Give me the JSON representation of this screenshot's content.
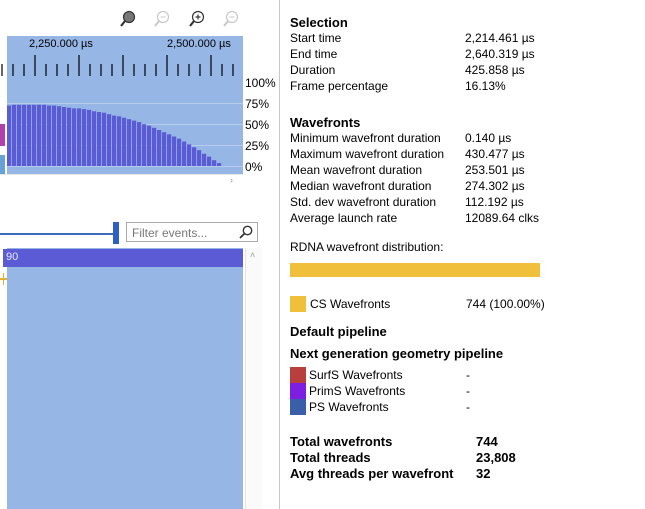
{
  "toolbar": {
    "icons": [
      "zoom-to-selection-icon",
      "zoom-reset-icon",
      "zoom-in-icon",
      "zoom-out-icon"
    ]
  },
  "timeline": {
    "tick_labels": [
      "2,250.000 µs",
      "2,500.000 µs"
    ],
    "percent_labels": [
      "100%",
      "75%",
      "50%",
      "25%",
      "0%"
    ]
  },
  "filter": {
    "placeholder": "Filter events..."
  },
  "event_lane": {
    "label": "90"
  },
  "selection": {
    "heading": "Selection",
    "rows": [
      {
        "label": "Start time",
        "value": "2,214.461 µs"
      },
      {
        "label": "End time",
        "value": "2,640.319 µs"
      },
      {
        "label": "Duration",
        "value": "425.858 µs"
      },
      {
        "label": "Frame percentage",
        "value": "16.13%"
      }
    ]
  },
  "wavefronts": {
    "heading": "Wavefronts",
    "rows": [
      {
        "label": "Minimum wavefront duration",
        "value": "0.140 µs"
      },
      {
        "label": "Maximum wavefront duration",
        "value": "430.477 µs"
      },
      {
        "label": "Mean wavefront duration",
        "value": "253.501 µs"
      },
      {
        "label": "Median wavefront duration",
        "value": "274.302 µs"
      },
      {
        "label": "Std. dev wavefront duration",
        "value": "112.192 µs"
      },
      {
        "label": "Average launch rate",
        "value": "12089.64 clks"
      }
    ]
  },
  "distribution": {
    "title": "RDNA wavefront distribution:",
    "bar_color": "#f0c03c",
    "bar_fraction": 1.0,
    "entries": [
      {
        "label": "CS Wavefronts",
        "value": "744 (100.00%)",
        "color": "#f0c03c"
      }
    ]
  },
  "default_pipeline": {
    "heading": "Default pipeline"
  },
  "ngg_pipeline": {
    "heading": "Next generation geometry pipeline",
    "entries": [
      {
        "label": "SurfS Wavefronts",
        "value": "-",
        "color": "#b8403c"
      },
      {
        "label": "PrimS Wavefronts",
        "value": "-",
        "color": "#7d1fe0"
      },
      {
        "label": "PS Wavefronts",
        "value": "-",
        "color": "#3b5ea8"
      }
    ]
  },
  "totals": {
    "rows": [
      {
        "label": "Total wavefronts",
        "value": "744"
      },
      {
        "label": "Total threads",
        "value": "23,808"
      },
      {
        "label": "Avg threads per wavefront",
        "value": "32"
      }
    ]
  },
  "colors": {
    "timeline_bg": "#96b6e6",
    "histogram_bar": "#5b5bd6",
    "lane_header": "#5b5bd6"
  },
  "histogram_levels": [
    0.84,
    0.85,
    0.85,
    0.85,
    0.85,
    0.85,
    0.85,
    0.85,
    0.84,
    0.84,
    0.83,
    0.82,
    0.81,
    0.8,
    0.8,
    0.79,
    0.78,
    0.76,
    0.75,
    0.74,
    0.72,
    0.7,
    0.69,
    0.67,
    0.65,
    0.63,
    0.61,
    0.58,
    0.56,
    0.53,
    0.5,
    0.47,
    0.44,
    0.41,
    0.38,
    0.34,
    0.3,
    0.26,
    0.22,
    0.17,
    0.13,
    0.08,
    0.04
  ]
}
